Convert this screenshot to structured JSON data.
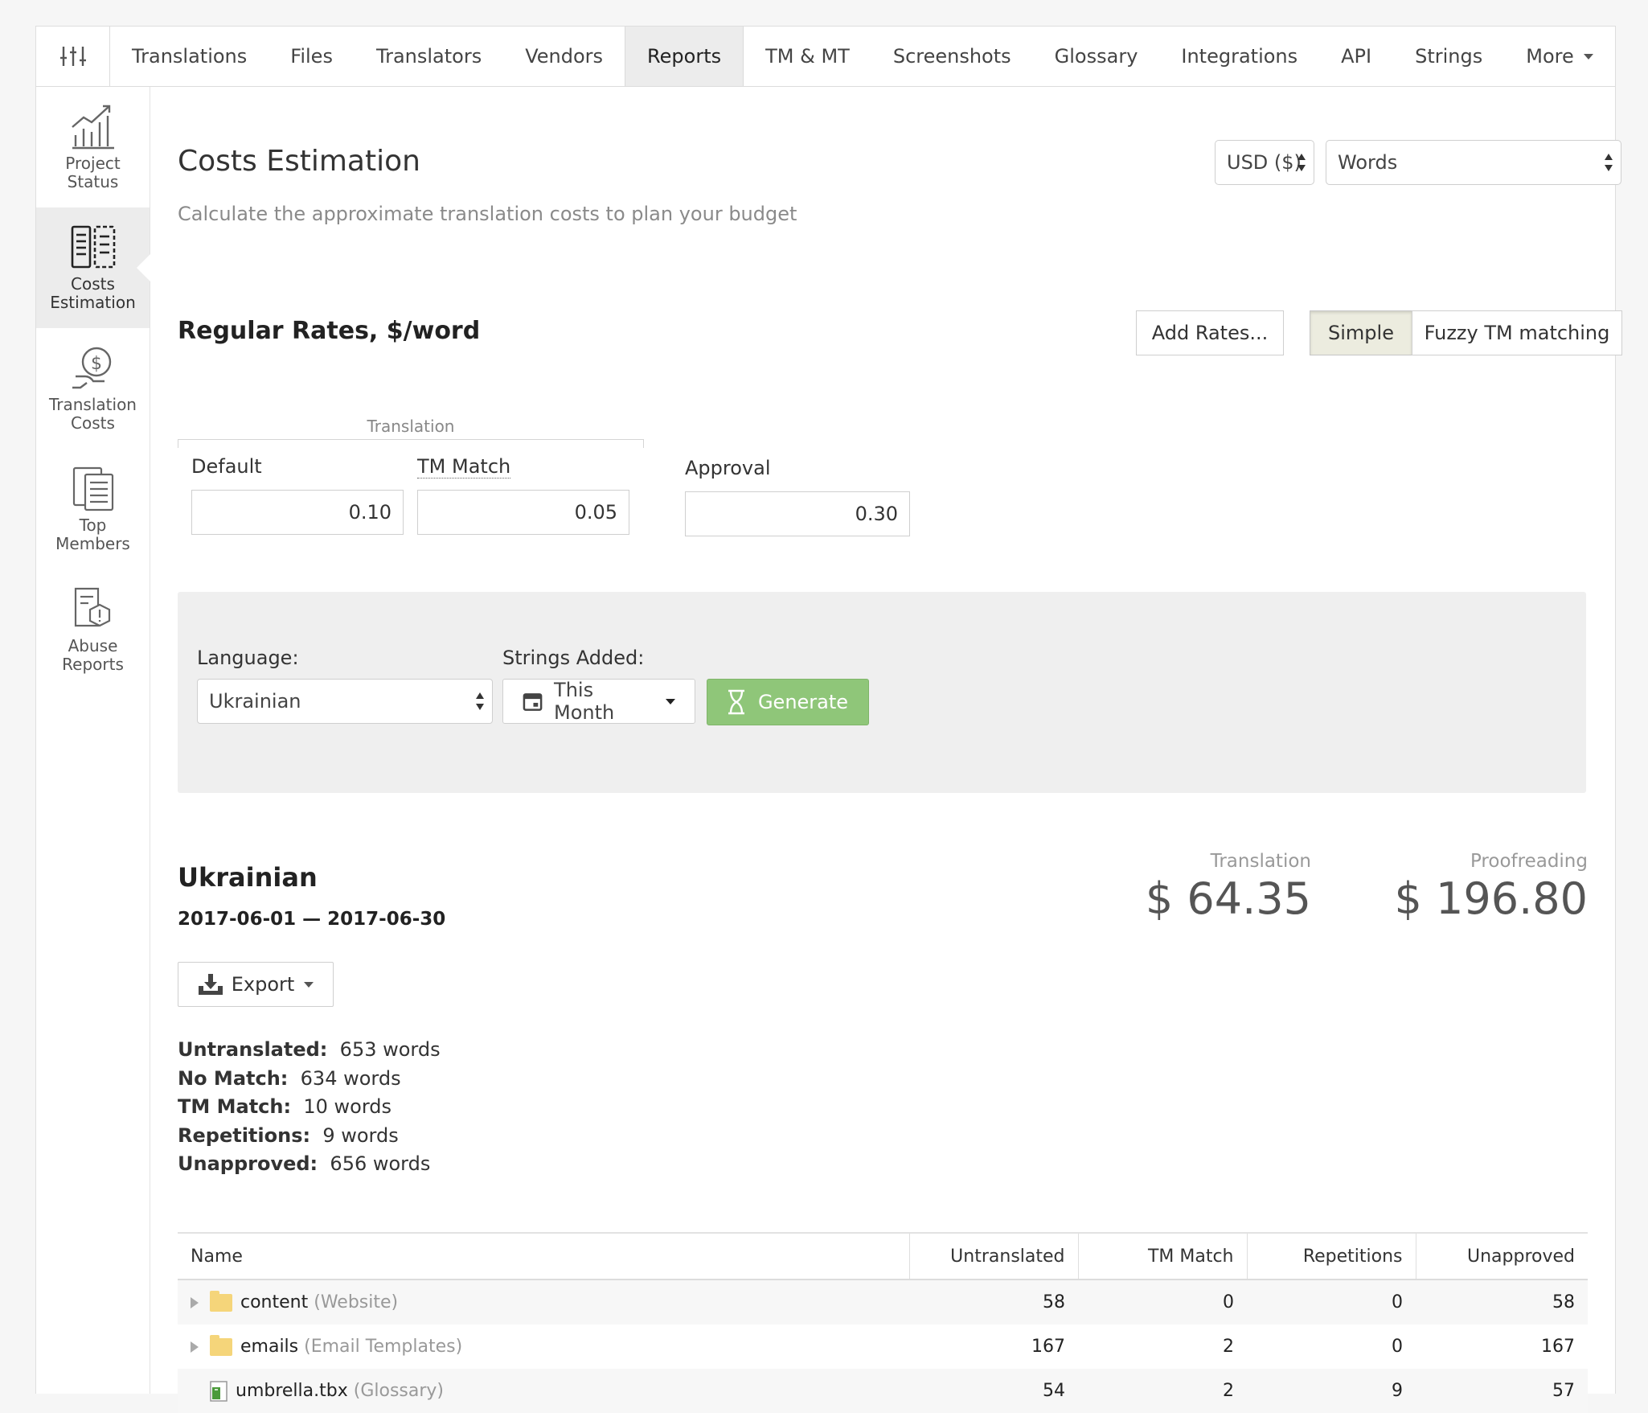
{
  "nav": {
    "tabs": [
      {
        "label": "Translations"
      },
      {
        "label": "Files"
      },
      {
        "label": "Translators"
      },
      {
        "label": "Vendors"
      },
      {
        "label": "Reports",
        "active": true
      },
      {
        "label": "TM & MT"
      },
      {
        "label": "Screenshots"
      },
      {
        "label": "Glossary"
      },
      {
        "label": "Integrations"
      },
      {
        "label": "API"
      },
      {
        "label": "Strings"
      }
    ],
    "more_label": "More"
  },
  "sidebar": {
    "items": [
      {
        "line1": "Project",
        "line2": "Status",
        "icon": "chart-icon"
      },
      {
        "line1": "Costs",
        "line2": "Estimation",
        "icon": "calculator-icon",
        "active": true
      },
      {
        "line1": "Translation",
        "line2": "Costs",
        "icon": "money-hand-icon"
      },
      {
        "line1": "Top",
        "line2": "Members",
        "icon": "document-list-icon"
      },
      {
        "line1": "Abuse",
        "line2": "Reports",
        "icon": "warning-document-icon"
      }
    ]
  },
  "header": {
    "title": "Costs Estimation",
    "subtitle": "Calculate the approximate translation costs to plan your budget",
    "currency": "USD ($)",
    "unit": "Words"
  },
  "rates": {
    "title": "Regular Rates, $/word",
    "add_rates_label": "Add Rates...",
    "mode_simple": "Simple",
    "mode_fuzzy": "Fuzzy TM matching",
    "group_label": "Translation",
    "default_label": "Default",
    "default_value": "0.10",
    "tm_match_label": "TM Match",
    "tm_match_value": "0.05",
    "approval_label": "Approval",
    "approval_value": "0.30"
  },
  "filters": {
    "language_label": "Language:",
    "language_value": "Ukrainian",
    "strings_added_label": "Strings Added:",
    "period_value": "This Month",
    "generate_label": "Generate"
  },
  "result": {
    "language": "Ukrainian",
    "date_range": "2017-06-01 — 2017-06-30",
    "export_label": "Export",
    "translation_label": "Translation",
    "translation_cost": "$ 64.35",
    "proofreading_label": "Proofreading",
    "proofreading_cost": "$ 196.80",
    "stats": [
      {
        "label": "Untranslated:",
        "value": "653 words"
      },
      {
        "label": "No Match:",
        "value": "634 words"
      },
      {
        "label": "TM Match:",
        "value": "10 words"
      },
      {
        "label": "Repetitions:",
        "value": "9 words"
      },
      {
        "label": "Unapproved:",
        "value": "656 words"
      }
    ]
  },
  "table": {
    "headers": [
      "Name",
      "Untranslated",
      "TM Match",
      "Repetitions",
      "Unapproved"
    ],
    "rows": [
      {
        "name": "content",
        "note": "(Website)",
        "untranslated": "58",
        "tm_match": "0",
        "repetitions": "0",
        "unapproved": "58"
      },
      {
        "name": "emails",
        "note": "(Email Templates)",
        "untranslated": "167",
        "tm_match": "2",
        "repetitions": "0",
        "unapproved": "167"
      },
      {
        "name": "umbrella.tbx",
        "note": "(Glossary)",
        "untranslated": "54",
        "tm_match": "2",
        "repetitions": "9",
        "unapproved": "57"
      }
    ]
  },
  "colors": {
    "generate": "#8fc679",
    "folder": "#f5d57a"
  }
}
